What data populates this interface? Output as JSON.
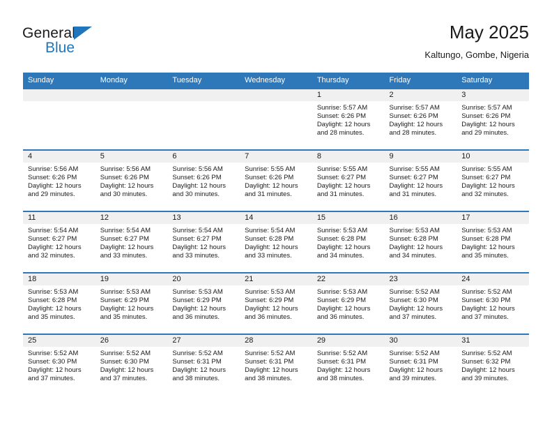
{
  "brand": {
    "name_top": "General",
    "name_bottom": "Blue",
    "accent_color": "#1f76bc"
  },
  "header": {
    "title": "May 2025",
    "subtitle": "Kaltungo, Gombe, Nigeria"
  },
  "theme": {
    "header_row_bg": "#2e78ba",
    "daynum_bg": "#f0f0f0",
    "cell_border": "#2e78ba",
    "text": "#1a1a1a"
  },
  "weekdays": [
    "Sunday",
    "Monday",
    "Tuesday",
    "Wednesday",
    "Thursday",
    "Friday",
    "Saturday"
  ],
  "labels": {
    "sunrise_prefix": "Sunrise:",
    "sunset_prefix": "Sunset:",
    "daylight_prefix": "Daylight:"
  },
  "weeks": [
    [
      {
        "day": "",
        "blank": true
      },
      {
        "day": "",
        "blank": true
      },
      {
        "day": "",
        "blank": true
      },
      {
        "day": "",
        "blank": true
      },
      {
        "day": "1",
        "sunrise": "Sunrise: 5:57 AM",
        "sunset": "Sunset: 6:26 PM",
        "daylight": "Daylight: 12 hours and 28 minutes."
      },
      {
        "day": "2",
        "sunrise": "Sunrise: 5:57 AM",
        "sunset": "Sunset: 6:26 PM",
        "daylight": "Daylight: 12 hours and 28 minutes."
      },
      {
        "day": "3",
        "sunrise": "Sunrise: 5:57 AM",
        "sunset": "Sunset: 6:26 PM",
        "daylight": "Daylight: 12 hours and 29 minutes."
      }
    ],
    [
      {
        "day": "4",
        "sunrise": "Sunrise: 5:56 AM",
        "sunset": "Sunset: 6:26 PM",
        "daylight": "Daylight: 12 hours and 29 minutes."
      },
      {
        "day": "5",
        "sunrise": "Sunrise: 5:56 AM",
        "sunset": "Sunset: 6:26 PM",
        "daylight": "Daylight: 12 hours and 30 minutes."
      },
      {
        "day": "6",
        "sunrise": "Sunrise: 5:56 AM",
        "sunset": "Sunset: 6:26 PM",
        "daylight": "Daylight: 12 hours and 30 minutes."
      },
      {
        "day": "7",
        "sunrise": "Sunrise: 5:55 AM",
        "sunset": "Sunset: 6:26 PM",
        "daylight": "Daylight: 12 hours and 31 minutes."
      },
      {
        "day": "8",
        "sunrise": "Sunrise: 5:55 AM",
        "sunset": "Sunset: 6:27 PM",
        "daylight": "Daylight: 12 hours and 31 minutes."
      },
      {
        "day": "9",
        "sunrise": "Sunrise: 5:55 AM",
        "sunset": "Sunset: 6:27 PM",
        "daylight": "Daylight: 12 hours and 31 minutes."
      },
      {
        "day": "10",
        "sunrise": "Sunrise: 5:55 AM",
        "sunset": "Sunset: 6:27 PM",
        "daylight": "Daylight: 12 hours and 32 minutes."
      }
    ],
    [
      {
        "day": "11",
        "sunrise": "Sunrise: 5:54 AM",
        "sunset": "Sunset: 6:27 PM",
        "daylight": "Daylight: 12 hours and 32 minutes."
      },
      {
        "day": "12",
        "sunrise": "Sunrise: 5:54 AM",
        "sunset": "Sunset: 6:27 PM",
        "daylight": "Daylight: 12 hours and 33 minutes."
      },
      {
        "day": "13",
        "sunrise": "Sunrise: 5:54 AM",
        "sunset": "Sunset: 6:27 PM",
        "daylight": "Daylight: 12 hours and 33 minutes."
      },
      {
        "day": "14",
        "sunrise": "Sunrise: 5:54 AM",
        "sunset": "Sunset: 6:28 PM",
        "daylight": "Daylight: 12 hours and 33 minutes."
      },
      {
        "day": "15",
        "sunrise": "Sunrise: 5:53 AM",
        "sunset": "Sunset: 6:28 PM",
        "daylight": "Daylight: 12 hours and 34 minutes."
      },
      {
        "day": "16",
        "sunrise": "Sunrise: 5:53 AM",
        "sunset": "Sunset: 6:28 PM",
        "daylight": "Daylight: 12 hours and 34 minutes."
      },
      {
        "day": "17",
        "sunrise": "Sunrise: 5:53 AM",
        "sunset": "Sunset: 6:28 PM",
        "daylight": "Daylight: 12 hours and 35 minutes."
      }
    ],
    [
      {
        "day": "18",
        "sunrise": "Sunrise: 5:53 AM",
        "sunset": "Sunset: 6:28 PM",
        "daylight": "Daylight: 12 hours and 35 minutes."
      },
      {
        "day": "19",
        "sunrise": "Sunrise: 5:53 AM",
        "sunset": "Sunset: 6:29 PM",
        "daylight": "Daylight: 12 hours and 35 minutes."
      },
      {
        "day": "20",
        "sunrise": "Sunrise: 5:53 AM",
        "sunset": "Sunset: 6:29 PM",
        "daylight": "Daylight: 12 hours and 36 minutes."
      },
      {
        "day": "21",
        "sunrise": "Sunrise: 5:53 AM",
        "sunset": "Sunset: 6:29 PM",
        "daylight": "Daylight: 12 hours and 36 minutes."
      },
      {
        "day": "22",
        "sunrise": "Sunrise: 5:53 AM",
        "sunset": "Sunset: 6:29 PM",
        "daylight": "Daylight: 12 hours and 36 minutes."
      },
      {
        "day": "23",
        "sunrise": "Sunrise: 5:52 AM",
        "sunset": "Sunset: 6:30 PM",
        "daylight": "Daylight: 12 hours and 37 minutes."
      },
      {
        "day": "24",
        "sunrise": "Sunrise: 5:52 AM",
        "sunset": "Sunset: 6:30 PM",
        "daylight": "Daylight: 12 hours and 37 minutes."
      }
    ],
    [
      {
        "day": "25",
        "sunrise": "Sunrise: 5:52 AM",
        "sunset": "Sunset: 6:30 PM",
        "daylight": "Daylight: 12 hours and 37 minutes."
      },
      {
        "day": "26",
        "sunrise": "Sunrise: 5:52 AM",
        "sunset": "Sunset: 6:30 PM",
        "daylight": "Daylight: 12 hours and 37 minutes."
      },
      {
        "day": "27",
        "sunrise": "Sunrise: 5:52 AM",
        "sunset": "Sunset: 6:31 PM",
        "daylight": "Daylight: 12 hours and 38 minutes."
      },
      {
        "day": "28",
        "sunrise": "Sunrise: 5:52 AM",
        "sunset": "Sunset: 6:31 PM",
        "daylight": "Daylight: 12 hours and 38 minutes."
      },
      {
        "day": "29",
        "sunrise": "Sunrise: 5:52 AM",
        "sunset": "Sunset: 6:31 PM",
        "daylight": "Daylight: 12 hours and 38 minutes."
      },
      {
        "day": "30",
        "sunrise": "Sunrise: 5:52 AM",
        "sunset": "Sunset: 6:31 PM",
        "daylight": "Daylight: 12 hours and 39 minutes."
      },
      {
        "day": "31",
        "sunrise": "Sunrise: 5:52 AM",
        "sunset": "Sunset: 6:32 PM",
        "daylight": "Daylight: 12 hours and 39 minutes."
      }
    ]
  ]
}
